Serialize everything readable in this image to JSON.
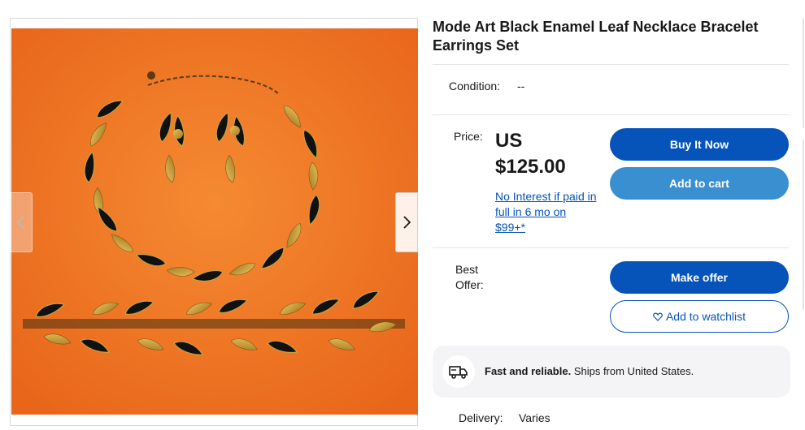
{
  "listing": {
    "title": "Mode Art Black Enamel Leaf Necklace Bracelet Earrings Set",
    "image_alt": "Black enamel and gold leaf necklace, bracelet and earrings on orange background"
  },
  "gallery": {
    "prev_icon": "chevron-left-icon",
    "next_icon": "chevron-right-icon"
  },
  "condition": {
    "label": "Condition:",
    "value": "--"
  },
  "price": {
    "label": "Price:",
    "currency": "US",
    "amount": "$125.00",
    "finance_text": "No Interest if paid in full in 6 mo on $99+*"
  },
  "buttons": {
    "buy_now": "Buy It Now",
    "add_to_cart": "Add to cart",
    "make_offer": "Make offer",
    "watchlist": "Add to watchlist"
  },
  "best_offer": {
    "label": "Best Offer:"
  },
  "shipping": {
    "bold": "Fast and reliable.",
    "text": " Ships from United States.",
    "icon": "truck-icon"
  },
  "delivery": {
    "label": "Delivery:",
    "value": "Varies"
  },
  "colors": {
    "primary_blue": "#0654ba",
    "secondary_blue": "#3a8fd0",
    "photo_background": "#f0731f"
  }
}
